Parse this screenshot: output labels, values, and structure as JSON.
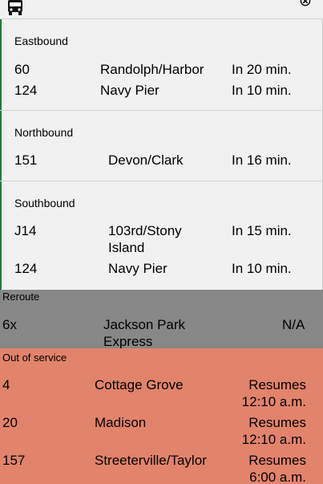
{
  "header": {
    "bus_icon": "bus-icon",
    "close_icon": "close-circle-icon"
  },
  "groups": [
    {
      "direction": "Eastbound",
      "rows": [
        {
          "route": "60",
          "destination": "Randolph/Harbor",
          "eta": "In 20 min."
        },
        {
          "route": "124",
          "destination": "Navy Pier",
          "eta": "In 10 min."
        }
      ]
    },
    {
      "direction": "Northbound",
      "rows": [
        {
          "route": "151",
          "destination": "Devon/Clark",
          "eta": "In 16 min."
        }
      ]
    },
    {
      "direction": "Southbound",
      "rows": [
        {
          "route": "J14",
          "destination_line1": "103rd/Stony",
          "destination_line2": "Island",
          "eta": "In 15 min."
        },
        {
          "route": "124",
          "destination": "Navy Pier",
          "eta": "In 10 min."
        }
      ]
    }
  ],
  "reroute": {
    "label": "Reroute",
    "row": {
      "route": "6x",
      "destination_line1": "Jackson Park",
      "destination_line2": "Express",
      "status": "N/A"
    }
  },
  "out_of_service": {
    "label": "Out of service",
    "rows": [
      {
        "route": "4",
        "destination": "Cottage Grove",
        "status_line1": "Resumes",
        "status_line2": "12:10 a.m."
      },
      {
        "route": "20",
        "destination": "Madison",
        "status_line1": "Resumes",
        "status_line2": "12:10 a.m."
      },
      {
        "route": "157",
        "destination": "Streeterville/Taylor",
        "status_line1": "Resumes",
        "status_line2": "6:00 a.m."
      }
    ]
  },
  "colors": {
    "reroute_bg": "#878787",
    "out_of_service_bg": "#e2836b",
    "accent_edge": "#1e7d3c"
  }
}
